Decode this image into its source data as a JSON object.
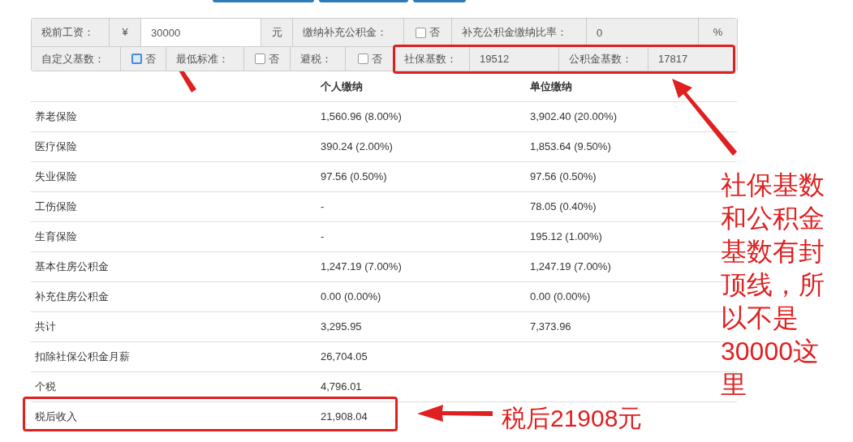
{
  "form": {
    "salary": {
      "label": "税前工资：",
      "currency": "¥",
      "value": "30000",
      "unit": "元"
    },
    "extra_fund": {
      "label": "缴纳补充公积金：",
      "option": "否",
      "checked": false,
      "focused": false
    },
    "extra_rate": {
      "label": "补充公积金缴纳比率：",
      "value": "0",
      "unit": "%"
    },
    "custom_base": {
      "label": "自定义基数：",
      "option": "否",
      "checked": false,
      "focused": true
    },
    "minimum": {
      "label": "最低标准：",
      "option": "否",
      "checked": false,
      "focused": false
    },
    "tax_avoid": {
      "label": "避税：",
      "option": "否",
      "checked": false,
      "focused": false
    },
    "social_base": {
      "label": "社保基数：",
      "value": "19512"
    },
    "fund_base": {
      "label": "公积金基数：",
      "value": "17817"
    }
  },
  "table": {
    "columns": [
      "个人缴纳",
      "单位缴纳"
    ],
    "rows": [
      {
        "label": "养老保险",
        "personal": "1,560.96 (8.00%)",
        "company": "3,902.40 (20.00%)"
      },
      {
        "label": "医疗保险",
        "personal": "390.24 (2.00%)",
        "company": "1,853.64 (9.50%)"
      },
      {
        "label": "失业保险",
        "personal": "97.56 (0.50%)",
        "company": "97.56 (0.50%)"
      },
      {
        "label": "工伤保险",
        "personal": "-",
        "company": "78.05 (0.40%)"
      },
      {
        "label": "生育保险",
        "personal": "-",
        "company": "195.12 (1.00%)"
      },
      {
        "label": "基本住房公积金",
        "personal": "1,247.19 (7.00%)",
        "company": "1,247.19 (7.00%)"
      },
      {
        "label": "补充住房公积金",
        "personal": "0.00 (0.00%)",
        "company": "0.00 (0.00%)"
      },
      {
        "label": "共计",
        "personal": "3,295.95",
        "company": "7,373.96"
      },
      {
        "label": "扣除社保公积金月薪",
        "personal": "26,704.05"
      },
      {
        "label": "个税",
        "personal": "4,796.01"
      },
      {
        "label": "税后收入",
        "personal": "21,908.04"
      }
    ]
  },
  "annotations": {
    "side_note": [
      "社保基数",
      "和公积金",
      "基数有封",
      "顶线，所",
      "以不是",
      "30000这",
      "里"
    ],
    "bottom_note": "税后21908元"
  }
}
